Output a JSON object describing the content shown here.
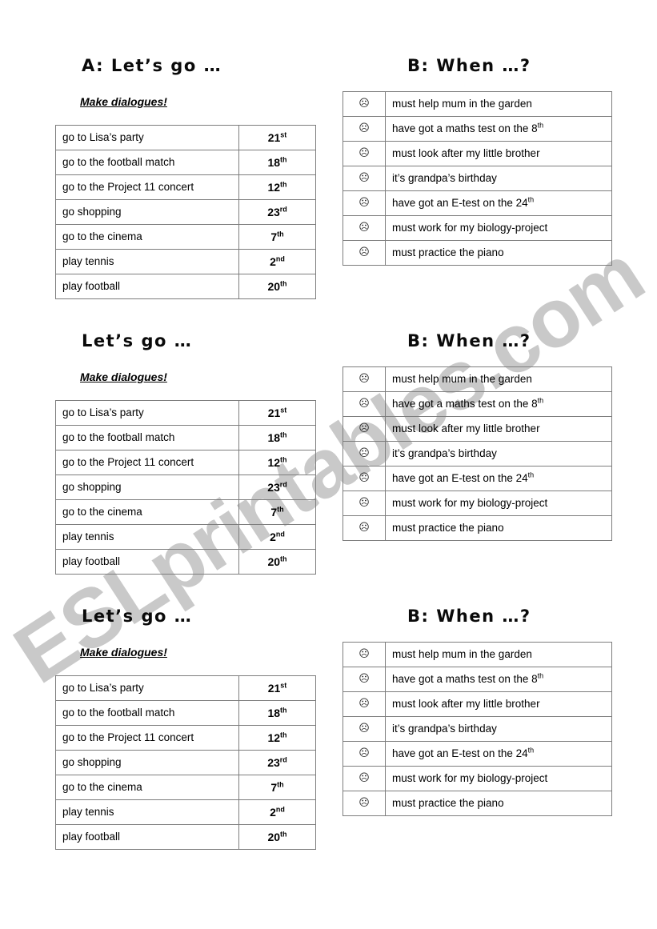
{
  "watermark": {
    "text": "ESLprintables.com",
    "color": "#c9c9c9"
  },
  "worksheet": {
    "subtitle": "Make dialogues!",
    "face_icon": "☹",
    "headings": {
      "left_with_prefix": "A: Let’s go …",
      "left_plain": "Let’s go …",
      "right": "B: When …?"
    },
    "activities": [
      {
        "text": "go to Lisa’s party",
        "date": "21",
        "ord": "st"
      },
      {
        "text": "go to the football match",
        "date": "18",
        "ord": "th"
      },
      {
        "text": "go to the Project 11 concert",
        "date": "12",
        "ord": "th"
      },
      {
        "text": "go shopping",
        "date": "23",
        "ord": "rd"
      },
      {
        "text": "go to the cinema",
        "date": "7",
        "ord": "th"
      },
      {
        "text": "play tennis",
        "date": "2",
        "ord": "nd"
      },
      {
        "text": "play football",
        "date": "20",
        "ord": "th"
      }
    ],
    "reasons": [
      {
        "text": "must help mum in the garden",
        "ord": ""
      },
      {
        "text": "have got a maths test on the 8",
        "ord": "th"
      },
      {
        "text": "must look after my little brother",
        "ord": ""
      },
      {
        "text": "it’s grandpa’s birthday",
        "ord": ""
      },
      {
        "text": "have got an E-test on the 24",
        "ord": "th"
      },
      {
        "text": "must work for my biology-project",
        "ord": ""
      },
      {
        "text": "must practice the piano",
        "ord": ""
      }
    ]
  }
}
